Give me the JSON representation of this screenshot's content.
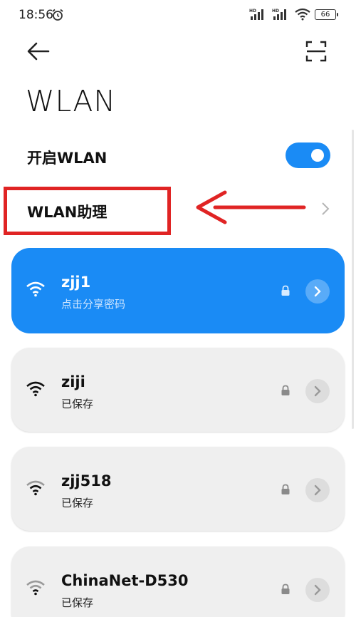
{
  "status_bar": {
    "time": "18:56",
    "battery_level": "66",
    "signal_labels": [
      "HD",
      "HD"
    ]
  },
  "header": {
    "title": "WLAN"
  },
  "wlan_toggle": {
    "label": "开启WLAN",
    "enabled": true,
    "accent_color": "#1a8bf5"
  },
  "assistant": {
    "label": "WLAN助理",
    "highlight_color": "#e02424"
  },
  "networks": [
    {
      "name": "zjj1",
      "subtitle": "点击分享密码",
      "connected": true,
      "secured": true,
      "signal": "full"
    },
    {
      "name": "ziji",
      "subtitle": "已保存",
      "connected": false,
      "secured": true,
      "signal": "full"
    },
    {
      "name": "zjj518",
      "subtitle": "已保存",
      "connected": false,
      "secured": true,
      "signal": "medium"
    },
    {
      "name": "ChinaNet-D530",
      "subtitle": "已保存",
      "connected": false,
      "secured": true,
      "signal": "low"
    }
  ]
}
